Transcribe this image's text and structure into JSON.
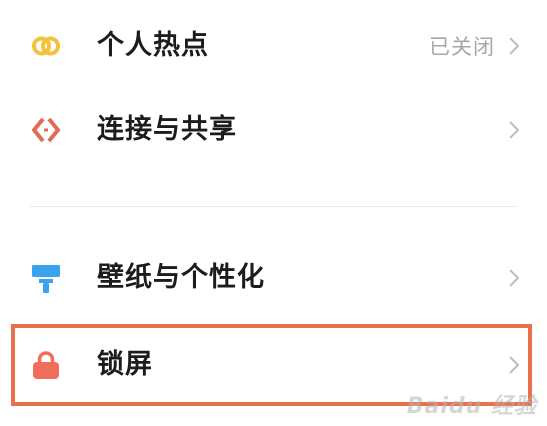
{
  "settings": {
    "items": [
      {
        "label": "个人热点",
        "status": "已关闭",
        "icon": "hotspot-link-icon"
      },
      {
        "label": "连接与共享",
        "status": "",
        "icon": "connection-share-icon"
      },
      {
        "label": "壁纸与个性化",
        "status": "",
        "icon": "wallpaper-brush-icon"
      },
      {
        "label": "锁屏",
        "status": "",
        "icon": "lock-icon"
      }
    ]
  },
  "colors": {
    "hotspot": "#f3c23a",
    "connection": "#e26b53",
    "wallpaper": "#3aa3f0",
    "lock": "#ef6f5a",
    "highlight_border": "#e8704a",
    "chevron": "#bdbdbd",
    "status_text": "#a7a7a7"
  },
  "watermark": "Baidu 经验"
}
